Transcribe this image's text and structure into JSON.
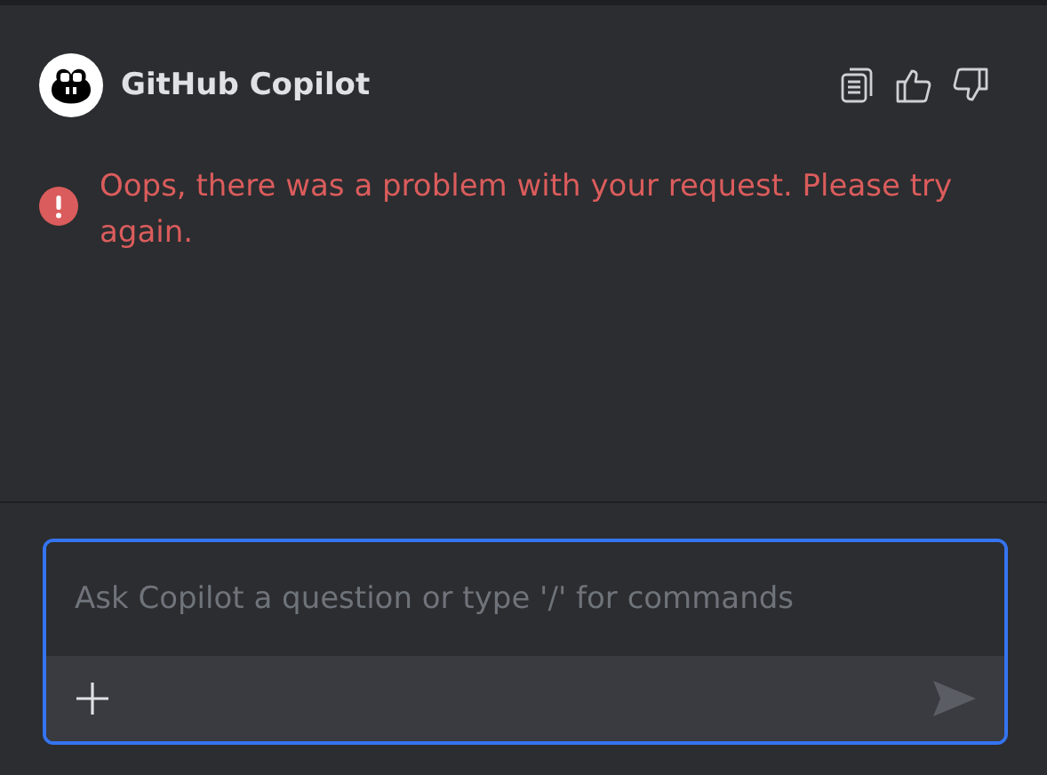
{
  "header": {
    "title": "GitHub Copilot"
  },
  "error": {
    "message": "Oops, there was a problem with your request. Please try again."
  },
  "input": {
    "placeholder": "Ask Copilot a question or type '/' for commands"
  }
}
